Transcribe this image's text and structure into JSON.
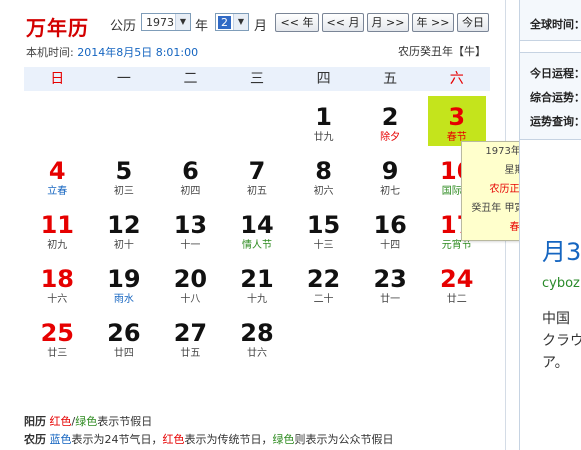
{
  "header": {
    "brand": "万年历",
    "calendar_type": "公历",
    "year_value": "1973",
    "year_unit": "年",
    "month_value": "2",
    "month_unit": "月",
    "nav_buttons": [
      "<< 年",
      "<< 月",
      "月 >>",
      "年 >>",
      "今日"
    ],
    "local_time_label": "本机时间:",
    "local_time_value": "2014年8月5日 8:01:00",
    "lunar_year": "农历癸丑年【牛】"
  },
  "weekdays": [
    "日",
    "一",
    "二",
    "三",
    "四",
    "五",
    "六"
  ],
  "days": [
    {
      "num": "1",
      "sub": "廿九",
      "subtype": "normal"
    },
    {
      "num": "2",
      "sub": "除夕",
      "subtype": "red"
    },
    {
      "num": "3",
      "sub": "春节",
      "subtype": "red"
    },
    {
      "num": "4",
      "sub": "立春",
      "subtype": "solar"
    },
    {
      "num": "5",
      "sub": "初三",
      "subtype": "normal"
    },
    {
      "num": "6",
      "sub": "初四",
      "subtype": "normal"
    },
    {
      "num": "7",
      "sub": "初五",
      "subtype": "normal"
    },
    {
      "num": "8",
      "sub": "初六",
      "subtype": "normal"
    },
    {
      "num": "9",
      "sub": "初七",
      "subtype": "normal"
    },
    {
      "num": "10",
      "sub": "国际气",
      "subtype": "green"
    },
    {
      "num": "11",
      "sub": "初九",
      "subtype": "normal"
    },
    {
      "num": "12",
      "sub": "初十",
      "subtype": "normal"
    },
    {
      "num": "13",
      "sub": "十一",
      "subtype": "normal"
    },
    {
      "num": "14",
      "sub": "情人节",
      "subtype": "green"
    },
    {
      "num": "15",
      "sub": "十三",
      "subtype": "normal"
    },
    {
      "num": "16",
      "sub": "十四",
      "subtype": "normal"
    },
    {
      "num": "17",
      "sub": "元宵节",
      "subtype": "green"
    },
    {
      "num": "18",
      "sub": "十六",
      "subtype": "normal"
    },
    {
      "num": "19",
      "sub": "雨水",
      "subtype": "solar"
    },
    {
      "num": "20",
      "sub": "十八",
      "subtype": "normal"
    },
    {
      "num": "21",
      "sub": "十九",
      "subtype": "normal"
    },
    {
      "num": "22",
      "sub": "二十",
      "subtype": "normal"
    },
    {
      "num": "23",
      "sub": "廿一",
      "subtype": "normal"
    },
    {
      "num": "24",
      "sub": "廿二",
      "subtype": "normal"
    },
    {
      "num": "25",
      "sub": "廿三",
      "subtype": "normal"
    },
    {
      "num": "26",
      "sub": "廿四",
      "subtype": "normal"
    },
    {
      "num": "27",
      "sub": "廿五",
      "subtype": "normal"
    },
    {
      "num": "28",
      "sub": "廿六",
      "subtype": "normal"
    }
  ],
  "first_weekday": 4,
  "today_num": "3",
  "tooltip": {
    "date": "1973年2月3日",
    "weekday": "星期六",
    "lunar": "农历正月初一",
    "ganzhi": "癸丑年 甲寅月 庚午日",
    "festival": "春节"
  },
  "legend": {
    "solar_label": "阳历",
    "solar_red": "红色",
    "slash": "/",
    "solar_green": "绿色",
    "solar_text": "表示节假日",
    "lunar_label": "农历",
    "lunar_blue": "蓝色",
    "lunar_text1": "表示为24节气日，",
    "lunar_red": "红色",
    "lunar_text2": "表示为传统节日，",
    "lunar_green": "绿色",
    "lunar_text3": "则表示为公众节假日"
  },
  "sidebar": {
    "global_time": "全球时间：",
    "today_luck": "今日运程：",
    "overall_luck": "综合运势：",
    "luck_query": "运势查询：",
    "big_text": "月3",
    "link_text": "cyboz",
    "jp_line1": "中国",
    "jp_line2": "クラウ",
    "jp_line3": "ア。"
  },
  "colors": {
    "red": "#e60000",
    "blue": "#1565c0",
    "green": "#2e8b20",
    "today_bg": "#c4e41c",
    "tooltip_bg": "#ffffcc"
  }
}
